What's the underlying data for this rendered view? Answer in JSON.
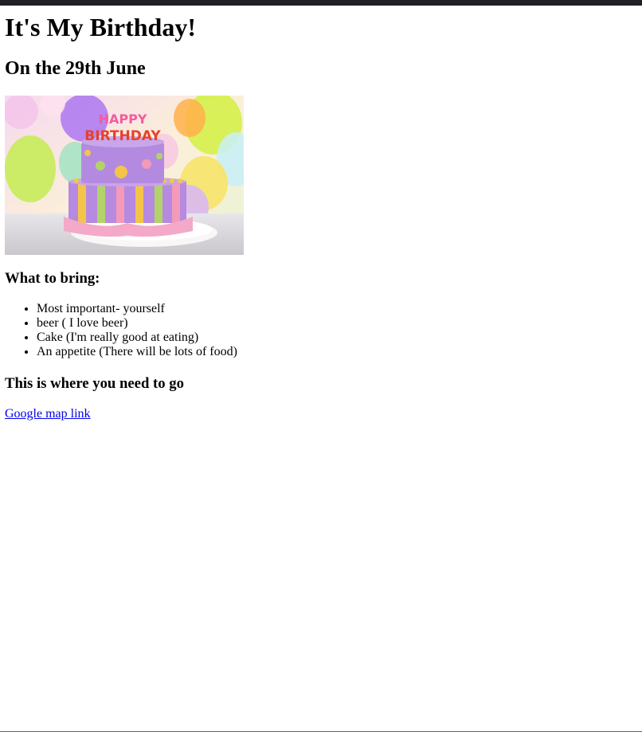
{
  "page": {
    "title": "It's My Birthday!",
    "date_heading": "On the 29th June",
    "cake_image": {
      "topper_line1": "HAPPY",
      "topper_line2": "BIRTHDAY"
    },
    "bring_heading": "What to bring:",
    "bring_items": [
      "Most important- yourself",
      "beer ( I love beer)",
      "Cake (I'm really good at eating)",
      "An appetite (There will be lots of food)"
    ],
    "location_heading": "This is where you need to go",
    "map_link_text": "Google map link"
  },
  "colors": {
    "link": "#0000ee",
    "frame_bar": "#202124"
  }
}
